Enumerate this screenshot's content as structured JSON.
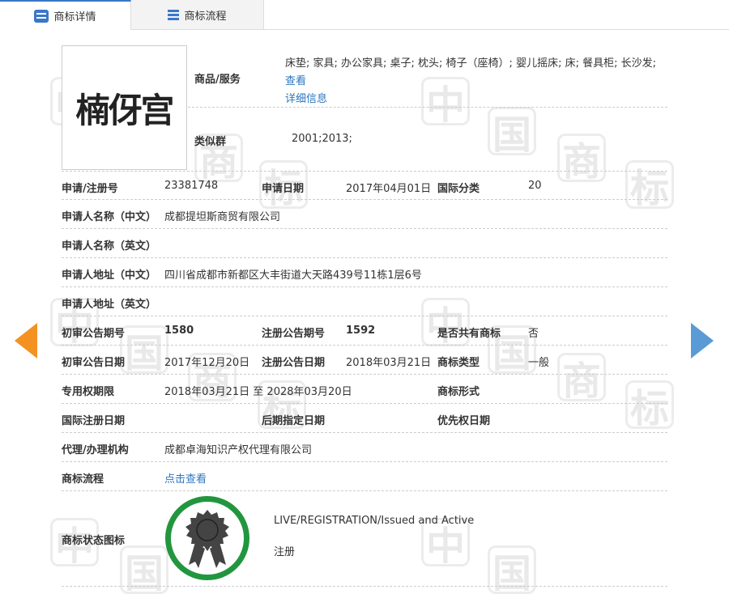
{
  "tabs": [
    {
      "label": "商标详情"
    },
    {
      "label": "商标流程"
    }
  ],
  "logo_text": "楠伢宫",
  "goods": {
    "label": "商品/服务",
    "value": "床垫; 家具; 办公家具; 桌子; 枕头; 椅子（座椅）; 婴儿摇床; 床; 餐具柜; 长沙发;",
    "link1": "查看",
    "link2": "详细信息"
  },
  "similar": {
    "label": "类似群",
    "value": "2001;2013;"
  },
  "reg_no": {
    "label": "申请/注册号",
    "value": "23381748"
  },
  "apply_date": {
    "label": "申请日期",
    "value": "2017年04月01日"
  },
  "intl_class": {
    "label": "国际分类",
    "value": "20"
  },
  "applicant_cn": {
    "label": "申请人名称（中文）",
    "value": "成都提坦斯商贸有限公司"
  },
  "applicant_en": {
    "label": "申请人名称（英文）",
    "value": ""
  },
  "address_cn": {
    "label": "申请人地址（中文）",
    "value": "四川省成都市新都区大丰街道大天路439号11栋1层6号"
  },
  "address_en": {
    "label": "申请人地址（英文）",
    "value": ""
  },
  "prelim_no": {
    "label": "初审公告期号",
    "value": "1580"
  },
  "reg_pub_no": {
    "label": "注册公告期号",
    "value": "1592"
  },
  "shared": {
    "label": "是否共有商标",
    "value": "否"
  },
  "prelim_date": {
    "label": "初审公告日期",
    "value": "2017年12月20日"
  },
  "reg_pub_date": {
    "label": "注册公告日期",
    "value": "2018年03月21日"
  },
  "mark_type": {
    "label": "商标类型",
    "value": "一般"
  },
  "term": {
    "label": "专用权期限",
    "value": "2018年03月21日 至 2028年03月20日"
  },
  "mark_form": {
    "label": "商标形式",
    "value": ""
  },
  "intl_reg_date": {
    "label": "国际注册日期",
    "value": ""
  },
  "later_date": {
    "label": "后期指定日期",
    "value": ""
  },
  "priority_date": {
    "label": "优先权日期",
    "value": ""
  },
  "agent": {
    "label": "代理/办理机构",
    "value": "成都卓海知识产权代理有限公司"
  },
  "flow": {
    "label": "商标流程",
    "link": "点击查看"
  },
  "status": {
    "label": "商标状态图标",
    "line1": "LIVE/REGISTRATION/Issued and Active",
    "line2": "注册"
  },
  "watermark": [
    "中",
    "国",
    "商",
    "标"
  ],
  "colors": {
    "accent": "#3b78c8",
    "link": "#2b76c0",
    "arrow_left": "#f39221",
    "arrow_right": "#5b9bd5",
    "badge_ring": "#22963e"
  }
}
